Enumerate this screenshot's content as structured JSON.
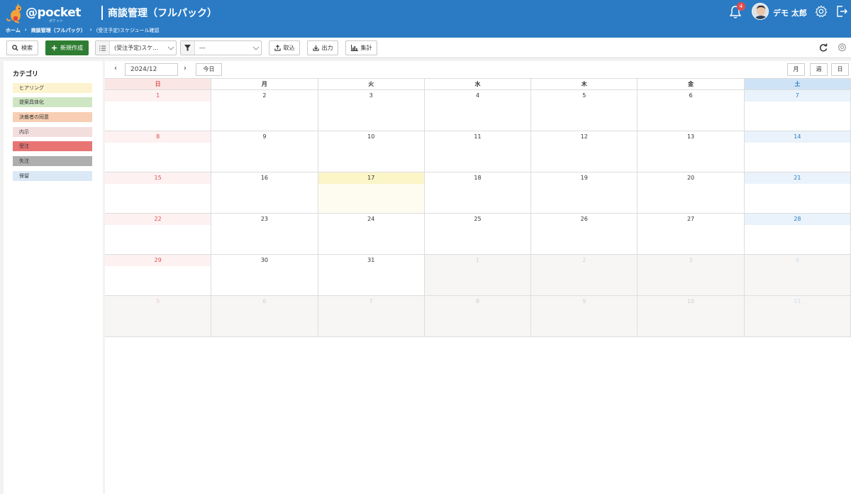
{
  "header": {
    "logo_text": "@pocket",
    "logo_sub": "ポケット",
    "app_title": "商談管理（フルパック）",
    "notification_count": "4",
    "user_name": "デモ 太郎"
  },
  "breadcrumb": {
    "home": "ホーム",
    "sep1": "›",
    "section": "商談管理（フルパック）",
    "sep2": "›",
    "current": "(受注予定)スケジュール確認"
  },
  "toolbar": {
    "search_label": "検索",
    "new_label": "新規作成",
    "view_select": "(受注予定)スケ…",
    "filter_select": "---",
    "import_label": "取込",
    "export_label": "出力",
    "aggregate_label": "集計"
  },
  "sidebar": {
    "title": "カテゴリ",
    "categories": [
      {
        "label": "ヒアリング",
        "color": "#fdf3cf"
      },
      {
        "label": "提案具体化",
        "color": "#cfe6c4"
      },
      {
        "label": "決裁者の同意",
        "color": "#f8cfb4"
      },
      {
        "label": "内示",
        "color": "#f3dede"
      },
      {
        "label": "受注",
        "color": "#e87474"
      },
      {
        "label": "失注",
        "color": "#aeaeae"
      },
      {
        "label": "保留",
        "color": "#dbe8f6"
      }
    ]
  },
  "calendar": {
    "month": "2024/12",
    "prev": "‹",
    "next": "›",
    "today_label": "今日",
    "view_month": "月",
    "view_week": "週",
    "view_day": "日",
    "weekdays": [
      "日",
      "月",
      "火",
      "水",
      "木",
      "金",
      "土"
    ],
    "weeks": [
      [
        "1",
        "2",
        "3",
        "4",
        "5",
        "6",
        "7"
      ],
      [
        "8",
        "9",
        "10",
        "11",
        "12",
        "13",
        "14"
      ],
      [
        "15",
        "16",
        "17",
        "18",
        "19",
        "20",
        "21"
      ],
      [
        "22",
        "23",
        "24",
        "25",
        "26",
        "27",
        "28"
      ],
      [
        "29",
        "30",
        "31",
        "1",
        "2",
        "3",
        "4"
      ],
      [
        "5",
        "6",
        "7",
        "8",
        "9",
        "10",
        "11"
      ]
    ],
    "today_date": "17"
  },
  "colors": {
    "header": "#2a7bc4",
    "primary_button": "#2f7d32",
    "sunday": "#e05050",
    "saturday": "#2a7bc4"
  }
}
